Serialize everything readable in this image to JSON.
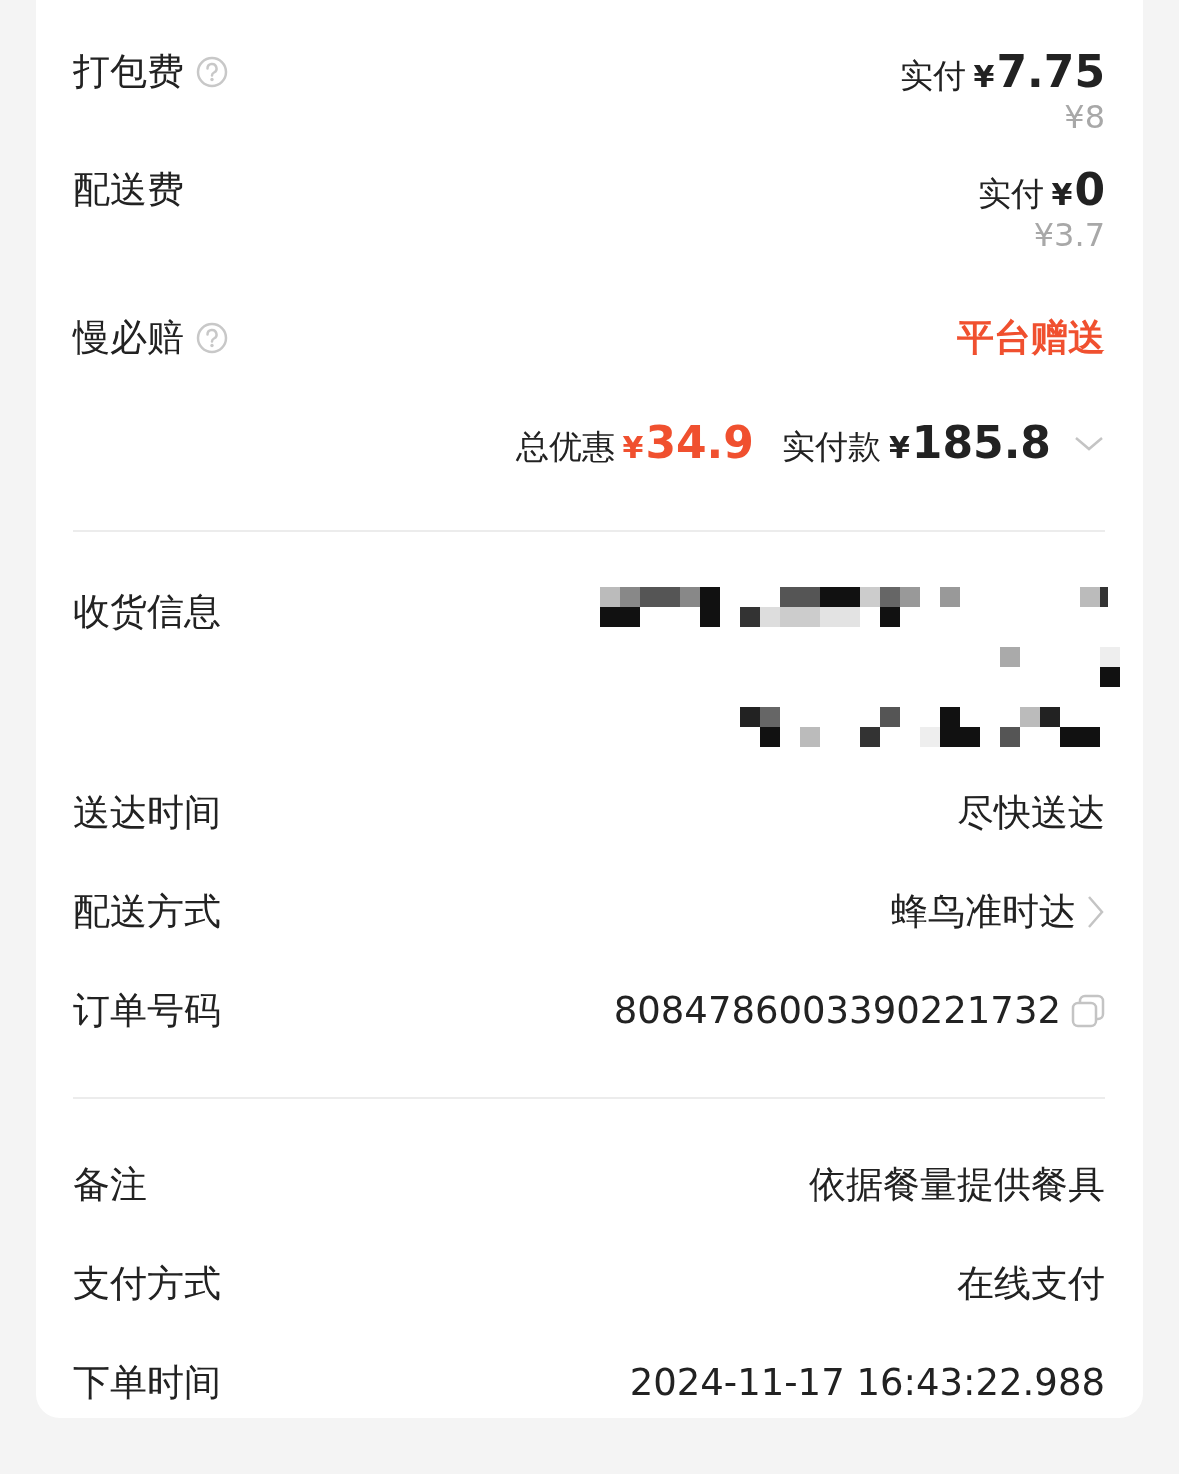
{
  "fees": [
    {
      "label": "打包费",
      "help": true,
      "paid_label": "实付",
      "currency": "¥",
      "paid": "7.75",
      "original": "¥8"
    },
    {
      "label": "配送费",
      "help": false,
      "paid_label": "实付",
      "currency": "¥",
      "paid": "0",
      "original": "¥3.7"
    },
    {
      "label": "慢必赔",
      "help": true,
      "tag": "平台赠送"
    }
  ],
  "summary": {
    "discount_label": "总优惠",
    "discount_currency": "¥",
    "discount": "34.9",
    "paid_label": "实付款",
    "paid_currency": "¥",
    "paid": "185.8",
    "expanded": false
  },
  "delivery": [
    {
      "label": "收货信息",
      "kind": "redacted"
    },
    {
      "label": "送达时间",
      "kind": "text",
      "value": "尽快送达"
    },
    {
      "label": "配送方式",
      "kind": "link",
      "value": "蜂鸟准时达"
    },
    {
      "label": "订单号码",
      "kind": "copy",
      "value": "8084786003390221732"
    }
  ],
  "order": [
    {
      "label": "备注",
      "value": "依据餐量提供餐具"
    },
    {
      "label": "支付方式",
      "value": "在线支付"
    },
    {
      "label": "下单时间",
      "value": "2024-11-17 16:43:22.988"
    }
  ]
}
